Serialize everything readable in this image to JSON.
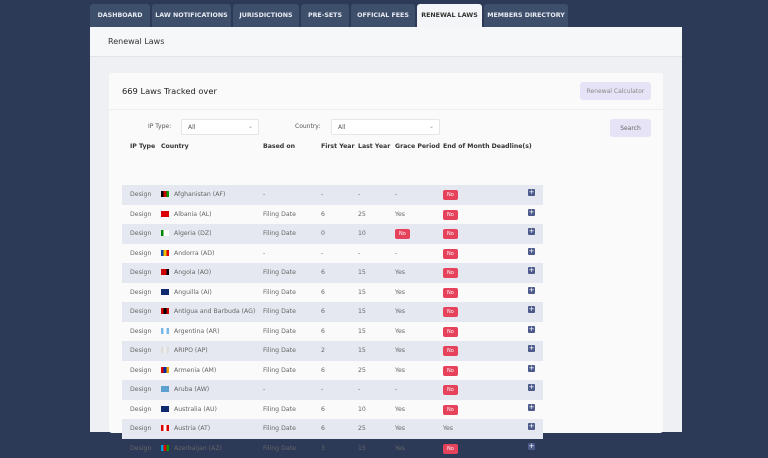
{
  "tabs": [
    {
      "label": "DASHBOARD"
    },
    {
      "label": "LAW NOTIFICATIONS"
    },
    {
      "label": "JURISDICTIONS"
    },
    {
      "label": "PRE-SETS"
    },
    {
      "label": "OFFICIAL FEES"
    },
    {
      "label": "RENEWAL LAWS",
      "active": true
    },
    {
      "label": "MEMBERS DIRECTORY"
    }
  ],
  "page_title": "Renewal Laws",
  "card": {
    "title": "669 Laws Tracked over",
    "calc_button": "Renewal Calculator"
  },
  "filters": {
    "ip_type_label": "IP Type:",
    "ip_type_value": "All",
    "country_label": "Country:",
    "country_value": "All",
    "search_button": "Search"
  },
  "columns": [
    "IP Type",
    "Country",
    "Based on",
    "First Year",
    "Last Year",
    "Grace Period",
    "End of Month Deadline(s)"
  ],
  "rows": [
    {
      "ip": "Design",
      "country": "Afghanistan (AF)",
      "based": "-",
      "first": "-",
      "last": "-",
      "grace": "-",
      "eom": "No",
      "flag": [
        "#000",
        "#c00",
        "#090"
      ]
    },
    {
      "ip": "Design",
      "country": "Albania (AL)",
      "based": "Filing Date",
      "first": "6",
      "last": "25",
      "grace": "Yes",
      "eom": "No",
      "flag": [
        "#d00",
        "#d00",
        "#d00"
      ]
    },
    {
      "ip": "Design",
      "country": "Algeria (DZ)",
      "based": "Filing Date",
      "first": "0",
      "last": "10",
      "grace": "No",
      "eom": "No",
      "flag": [
        "#080",
        "#fff",
        "#fff"
      ]
    },
    {
      "ip": "Design",
      "country": "Andorra (AD)",
      "based": "-",
      "first": "-",
      "last": "-",
      "grace": "-",
      "eom": "No",
      "flag": [
        "#1040a0",
        "#f0c000",
        "#d00"
      ]
    },
    {
      "ip": "Design",
      "country": "Angola (AO)",
      "based": "Filing Date",
      "first": "6",
      "last": "15",
      "grace": "Yes",
      "eom": "No",
      "flag": [
        "#c00",
        "#c00",
        "#000"
      ]
    },
    {
      "ip": "Design",
      "country": "Anguilla (AI)",
      "based": "Filing Date",
      "first": "6",
      "last": "15",
      "grace": "Yes",
      "eom": "No",
      "flag": [
        "#102a70",
        "#102a70",
        "#102a70"
      ]
    },
    {
      "ip": "Design",
      "country": "Antigua and Barbuda (AG)",
      "based": "Filing Date",
      "first": "6",
      "last": "15",
      "grace": "Yes",
      "eom": "No",
      "flag": [
        "#c00",
        "#000",
        "#c00"
      ]
    },
    {
      "ip": "Design",
      "country": "Argentina (AR)",
      "based": "Filing Date",
      "first": "6",
      "last": "15",
      "grace": "Yes",
      "eom": "No",
      "flag": [
        "#7ab8e8",
        "#fff",
        "#7ab8e8"
      ]
    },
    {
      "ip": "Design",
      "country": "ARIPO (AP)",
      "based": "Filing Date",
      "first": "2",
      "last": "15",
      "grace": "Yes",
      "eom": "No",
      "flag": [
        "#ddd",
        "#eee",
        "#ddd"
      ]
    },
    {
      "ip": "Design",
      "country": "Armenia (AM)",
      "based": "Filing Date",
      "first": "6",
      "last": "25",
      "grace": "Yes",
      "eom": "No",
      "flag": [
        "#d00",
        "#0030a0",
        "#f0a000"
      ]
    },
    {
      "ip": "Design",
      "country": "Aruba (AW)",
      "based": "-",
      "first": "-",
      "last": "-",
      "grace": "-",
      "eom": "No",
      "flag": [
        "#5aa0d0",
        "#5aa0d0",
        "#5aa0d0"
      ]
    },
    {
      "ip": "Design",
      "country": "Australia (AU)",
      "based": "Filing Date",
      "first": "6",
      "last": "10",
      "grace": "Yes",
      "eom": "No",
      "flag": [
        "#102a70",
        "#102a70",
        "#102a70"
      ]
    },
    {
      "ip": "Design",
      "country": "Austria (AT)",
      "based": "Filing Date",
      "first": "6",
      "last": "25",
      "grace": "Yes",
      "eom": "Yes",
      "flag": [
        "#d00",
        "#fff",
        "#d00"
      ]
    },
    {
      "ip": "Design",
      "country": "Azerbaijan (AZ)",
      "based": "Filing Date",
      "first": "3",
      "last": "15",
      "grace": "Yes",
      "eom": "No",
      "flag": [
        "#00a0d0",
        "#d00",
        "#090"
      ]
    }
  ],
  "colors": {
    "background": "#2c3a58",
    "no_badge": "#e6425c",
    "tab": "#3e4f6c"
  }
}
